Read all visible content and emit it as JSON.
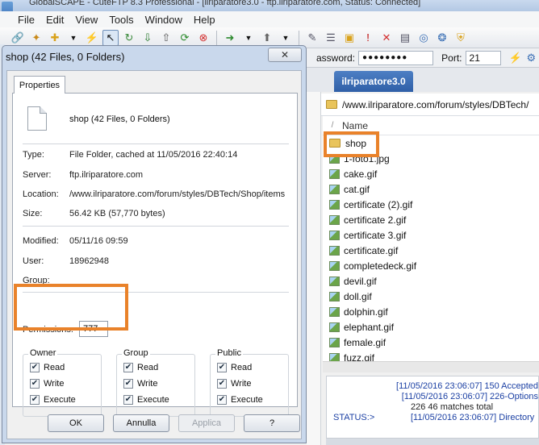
{
  "app": {
    "title_partial": "GlobalSCAPE - CuteFTP 8.3 Professional - [ilriparatore3.0 - ftp.ilriparatore.com, Status: Connected]",
    "menu": [
      "File",
      "Edit",
      "View",
      "Tools",
      "Window",
      "Help"
    ]
  },
  "toolbar": {
    "icons": [
      "connect-icon",
      "wizard-icon",
      "new-icon",
      "dropdown-icon",
      "disconnect-icon",
      "select-icon",
      "reconnect-icon",
      "download-icon",
      "upload-icon",
      "refresh-icon",
      "stop-icon",
      "go-icon",
      "queue-icon",
      "sort-icon",
      "edit-icon",
      "new-folder-icon",
      "alert-icon",
      "delete-icon",
      "properties-icon",
      "sync-icon",
      "help-icon",
      "shield-icon"
    ]
  },
  "connection": {
    "password_label": "assword:",
    "password_value": "●●●●●●●●",
    "port_label": "Port:",
    "port_value": "21"
  },
  "remote": {
    "tab_label": "ilriparatore3.0",
    "path": "/www.ilriparatore.com/forum/styles/DBTech/",
    "name_header": "Name",
    "sort_mark": "/",
    "files": [
      "shop",
      "1-foto1.jpg",
      "cake.gif",
      "cat.gif",
      "certificate (2).gif",
      "certificate 2.gif",
      "certificate 3.gif",
      "certificate.gif",
      "completedeck.gif",
      "devil.gif",
      "doll.gif",
      "dolphin.gif",
      "elephant.gif",
      "female.gif",
      "fuzz.gif"
    ]
  },
  "log": [
    {
      "type": "",
      "text": "[11/05/2016 23:06:07] 150 Accepted"
    },
    {
      "type": "",
      "text": "[11/05/2016 23:06:07] 226-Options"
    },
    {
      "type": "",
      "text": "226 46 matches total"
    },
    {
      "type": "STATUS:>",
      "text": "[11/05/2016 23:06:07] Directory"
    }
  ],
  "dialog": {
    "title": "shop (42 Files, 0 Folders)",
    "close_label": "✕",
    "tab_label": "Properties",
    "name": "shop (42 Files, 0 Folders)",
    "type_label": "Type:",
    "type_value": "File Folder, cached at 11/05/2016 22:40:14",
    "server_label": "Server:",
    "server_value": "ftp.ilriparatore.com",
    "location_label": "Location:",
    "location_value": "/www.ilriparatore.com/forum/styles/DBTech/Shop/items",
    "size_label": "Size:",
    "size_value": "56.42 KB (57,770 bytes)",
    "modified_label": "Modified:",
    "modified_value": "05/11/16 09:59",
    "user_label": "User:",
    "user_value": "18962948",
    "group_label": "Group:",
    "group_value": "",
    "permissions_label": "Permissions:",
    "permissions_value": "777",
    "groups": [
      {
        "title": "Owner",
        "read": "Read",
        "write": "Write",
        "execute": "Execute"
      },
      {
        "title": "Group",
        "read": "Read",
        "write": "Write",
        "execute": "Execute"
      },
      {
        "title": "Public",
        "read": "Read",
        "write": "Write",
        "execute": "Execute"
      }
    ],
    "buttons": {
      "ok": "OK",
      "cancel": "Annulla",
      "apply": "Applica",
      "help": "?"
    }
  },
  "colors": {
    "highlight": "#e9822a",
    "tab_active": "#2f5fa7",
    "log_text": "#1a3fa3"
  }
}
